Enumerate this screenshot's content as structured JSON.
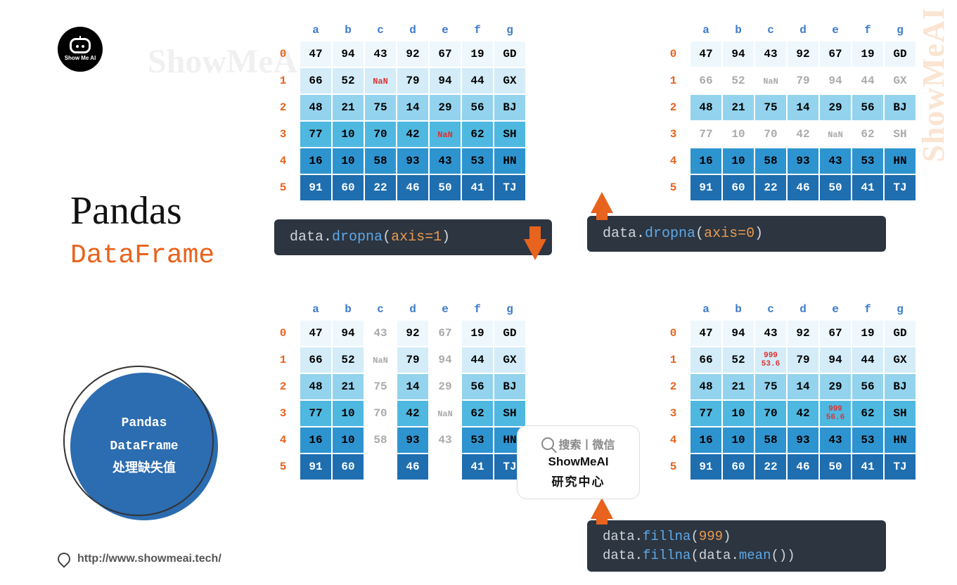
{
  "logo_text": "Show Me AI",
  "title": "Pandas",
  "subtitle": "DataFrame",
  "circle": {
    "l1": "Pandas",
    "l2": "DataFrame",
    "l3": "处理缺失值"
  },
  "footer": "http://www.showmeai.tech/",
  "watermark": "ShowMeAI",
  "cols": [
    "a",
    "b",
    "c",
    "d",
    "e",
    "f",
    "g"
  ],
  "idx": [
    "0",
    "1",
    "2",
    "3",
    "4",
    "5"
  ],
  "table_main": [
    [
      "47",
      "94",
      "43",
      "92",
      "67",
      "19",
      "GD"
    ],
    [
      "66",
      "52",
      "NaN",
      "79",
      "94",
      "44",
      "GX"
    ],
    [
      "48",
      "21",
      "75",
      "14",
      "29",
      "56",
      "BJ"
    ],
    [
      "77",
      "10",
      "70",
      "42",
      "NaN",
      "62",
      "SH"
    ],
    [
      "16",
      "10",
      "58",
      "93",
      "43",
      "53",
      "HN"
    ],
    [
      "91",
      "60",
      "22",
      "46",
      "50",
      "41",
      "TJ"
    ]
  ],
  "faded_axis0_rows": [
    1,
    3
  ],
  "faded_axis1_cols": [
    2,
    4
  ],
  "fillna_c1": {
    "top": "999",
    "bot": "53.6"
  },
  "fillna_e3": {
    "top": "999",
    "bot": "56.6"
  },
  "code1": {
    "obj": "data",
    "method": "dropna",
    "arg": "axis=1"
  },
  "code2": {
    "obj": "data",
    "method": "dropna",
    "arg": "axis=0"
  },
  "code3_l1": {
    "obj": "data",
    "method": "fillna",
    "arg": "999"
  },
  "code3_l2": {
    "obj": "data",
    "method": "fillna",
    "arg_obj": "data",
    "arg_method": "mean"
  },
  "search": {
    "l1": "搜索丨微信",
    "l2": "ShowMeAI",
    "l3": "研究中心"
  }
}
